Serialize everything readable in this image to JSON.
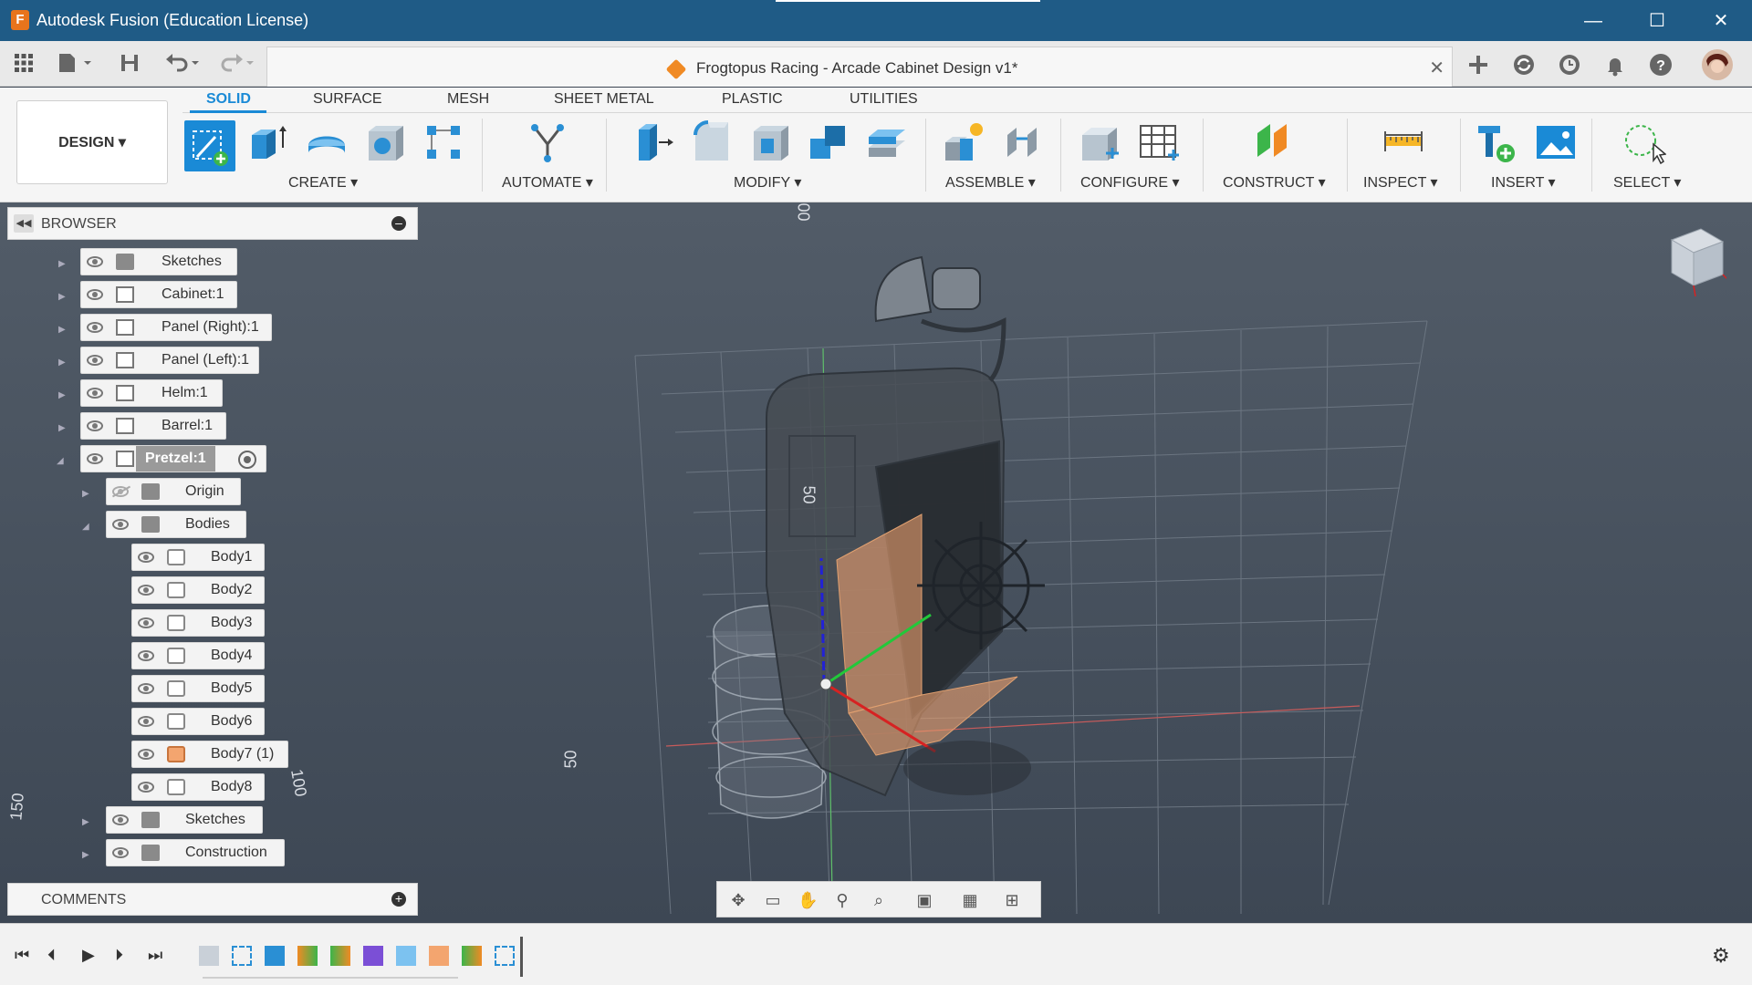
{
  "window": {
    "title": "Autodesk Fusion (Education License)",
    "app_icon_letter": "F",
    "minimize_glyph": "—",
    "maximize_glyph": "☐",
    "close_glyph": "✕"
  },
  "document": {
    "title": "Frogtopus Racing - Arcade Cabinet Design v1*",
    "close_glyph": "✕"
  },
  "workspace": {
    "label": "DESIGN ▾"
  },
  "ribbon": {
    "tabs": [
      "SOLID",
      "SURFACE",
      "MESH",
      "SHEET METAL",
      "PLASTIC",
      "UTILITIES"
    ],
    "groups": [
      "CREATE ▾",
      "AUTOMATE ▾",
      "MODIFY ▾",
      "ASSEMBLE ▾",
      "CONFIGURE ▾",
      "CONSTRUCT ▾",
      "INSPECT ▾",
      "INSERT ▾",
      "SELECT ▾"
    ]
  },
  "browser": {
    "title": "BROWSER",
    "items": [
      {
        "label": "Sketches",
        "icon": "folder-icon"
      },
      {
        "label": "Cabinet:1",
        "icon": "component-icon"
      },
      {
        "label": "Panel (Right):1",
        "icon": "component-icon"
      },
      {
        "label": "Panel (Left):1",
        "icon": "component-icon"
      },
      {
        "label": "Helm:1",
        "icon": "component-icon"
      },
      {
        "label": "Barrel:1",
        "icon": "component-icon"
      },
      {
        "label": "Pretzel:1",
        "icon": "component-icon"
      },
      {
        "label": "Origin",
        "icon": "folder-icon"
      },
      {
        "label": "Bodies",
        "icon": "folder-icon"
      },
      {
        "label": "Body1",
        "icon": "body-icon"
      },
      {
        "label": "Body2",
        "icon": "body-icon"
      },
      {
        "label": "Body3",
        "icon": "body-icon"
      },
      {
        "label": "Body4",
        "icon": "body-icon"
      },
      {
        "label": "Body5",
        "icon": "body-icon"
      },
      {
        "label": "Body6",
        "icon": "body-icon"
      },
      {
        "label": "Body7 (1)",
        "icon": "body-icon"
      },
      {
        "label": "Body8",
        "icon": "body-icon"
      },
      {
        "label": "Sketches",
        "icon": "folder-icon"
      },
      {
        "label": "Construction",
        "icon": "folder-icon"
      }
    ]
  },
  "comments": {
    "title": "COMMENTS"
  },
  "viewport": {
    "labels": [
      "00",
      "50",
      "50",
      "100",
      "150"
    ]
  },
  "colors": {
    "title_bar": "#1f5b86",
    "accent": "#1a8ad6",
    "orange": "#f08a24"
  }
}
